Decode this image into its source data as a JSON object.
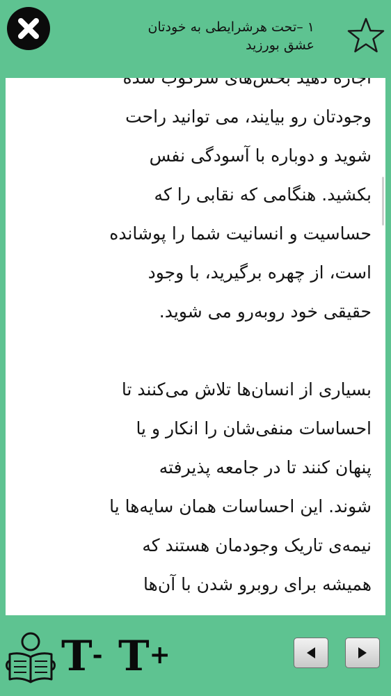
{
  "header": {
    "title_line1": "۱ –تحت هرشرایطی به خودتان",
    "title_line2": "عشق بورزید"
  },
  "content": {
    "paragraph1": [
      "اجازه دهید بخش‌های سرکوب شده",
      "وجودتان رو بیایند، می توانید راحت",
      "شوید و دوباره با آسودگی نفس",
      "بکشید. هنگامی که نقابی را که",
      "حساسیت و انسانیت شما را پوشانده",
      "است، از چهره برگیرید، با وجود",
      "حقیقی خود روبه‌رو می شوید."
    ],
    "paragraph2": [
      "بسیاری از انسان‌ها تلاش می‌کنند تا",
      "احساسات منفی‌شان را انکار و یا",
      "پنهان کنند تا در جامعه پذیرفته",
      "شوند. این احساسات همان سایه‌ها یا",
      "نیمه‌ی تاریک وجودمان هستند که",
      "همیشه برای روبرو شدن با آن‌ها"
    ]
  },
  "footer": {
    "font_decrease": "T",
    "font_decrease_sign": "-",
    "font_increase": "T",
    "font_increase_sign": "+"
  },
  "colors": {
    "background": "#5ec391",
    "page": "#ffffff",
    "text": "#141414"
  },
  "icons": [
    "close-icon",
    "star-icon",
    "reader-icon",
    "arrow-left-icon",
    "arrow-right-icon"
  ]
}
